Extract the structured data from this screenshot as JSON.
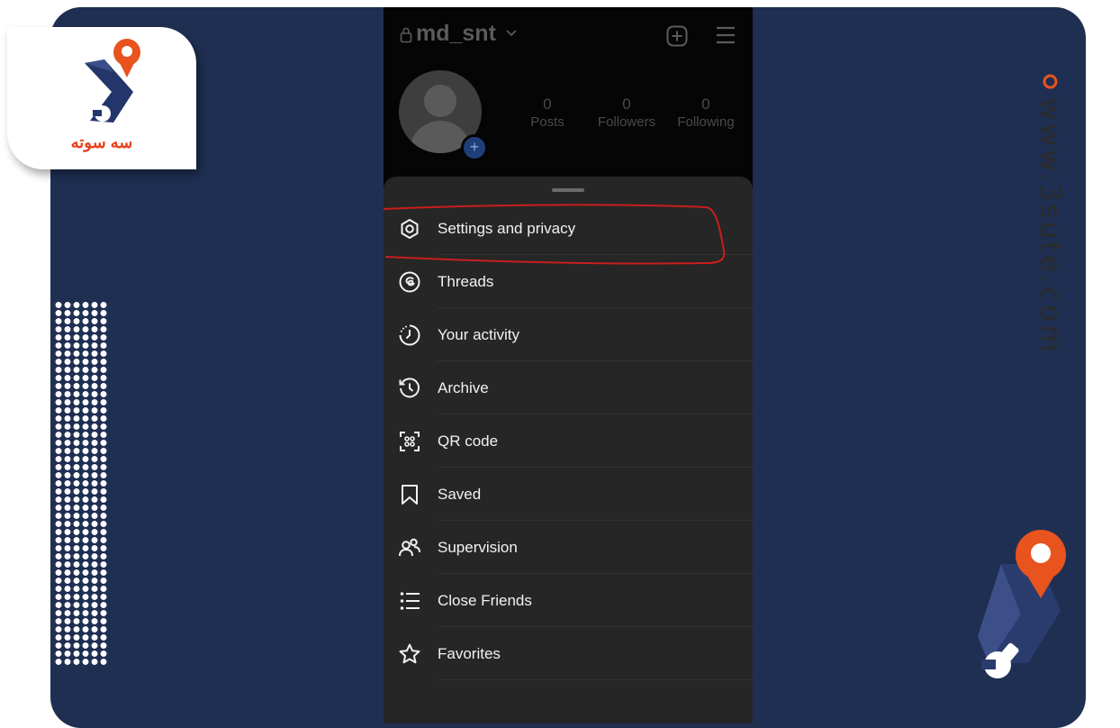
{
  "watermark": {
    "logo_text": "سه سوته",
    "site_url": "www.3sute.com",
    "accent_color": "#e8531e"
  },
  "profile": {
    "username": "md_snt",
    "stats": [
      {
        "value": "0",
        "label": "Posts"
      },
      {
        "value": "0",
        "label": "Followers"
      },
      {
        "value": "0",
        "label": "Following"
      }
    ],
    "icons": [
      "lock-icon",
      "chevron-down-icon",
      "plus-square-icon",
      "hamburger-menu-icon",
      "avatar-add-icon"
    ]
  },
  "menu": {
    "items": [
      {
        "label": "Settings and privacy",
        "icon": "settings-gear-icon",
        "highlighted": true
      },
      {
        "label": "Threads",
        "icon": "threads-icon"
      },
      {
        "label": "Your activity",
        "icon": "activity-clock-icon"
      },
      {
        "label": "Archive",
        "icon": "archive-history-icon"
      },
      {
        "label": "QR code",
        "icon": "qr-code-icon"
      },
      {
        "label": "Saved",
        "icon": "bookmark-icon"
      },
      {
        "label": "Supervision",
        "icon": "supervision-people-icon"
      },
      {
        "label": "Close Friends",
        "icon": "close-friends-list-icon"
      },
      {
        "label": "Favorites",
        "icon": "star-icon"
      }
    ]
  },
  "colors": {
    "frame_bg": "#1f2f52",
    "sheet_bg": "#262626",
    "annotation": "#c91d1d"
  }
}
